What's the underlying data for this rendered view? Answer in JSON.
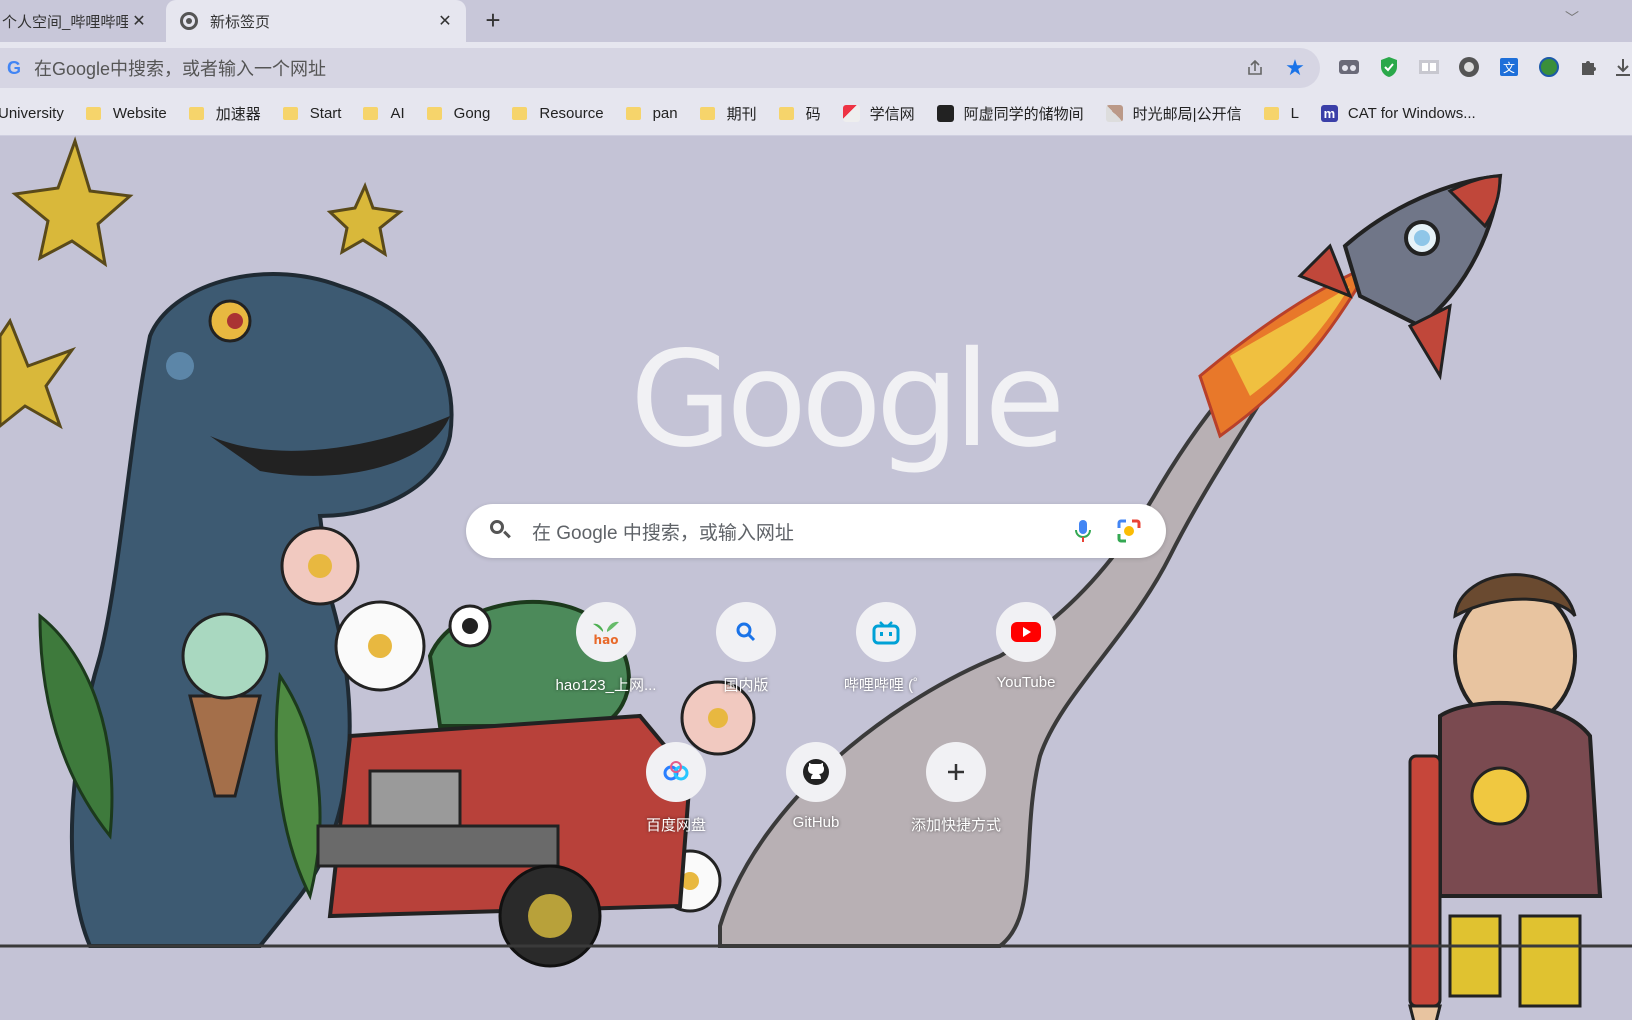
{
  "tabs": [
    {
      "title": "个人空间_哔哩哔哩",
      "active": false
    },
    {
      "title": "新标签页",
      "active": true
    }
  ],
  "omnibox": {
    "placeholder": "在Google中搜索，或者输入一个网址"
  },
  "bookmarks": [
    {
      "label": "University",
      "type": "folder"
    },
    {
      "label": "Website",
      "type": "folder"
    },
    {
      "label": "加速器",
      "type": "folder"
    },
    {
      "label": "Start",
      "type": "folder"
    },
    {
      "label": "AI",
      "type": "folder"
    },
    {
      "label": "Gong",
      "type": "folder"
    },
    {
      "label": "Resource",
      "type": "folder"
    },
    {
      "label": "pan",
      "type": "folder"
    },
    {
      "label": "期刊",
      "type": "folder"
    },
    {
      "label": "码",
      "type": "folder"
    },
    {
      "label": "学信网",
      "type": "site"
    },
    {
      "label": "阿虚同学的储物间",
      "type": "site"
    },
    {
      "label": "时光邮局|公开信",
      "type": "site"
    },
    {
      "label": "L",
      "type": "folder"
    },
    {
      "label": "CAT for Windows...",
      "type": "site"
    }
  ],
  "ntp": {
    "logo": "Google",
    "search_placeholder": "在 Google 中搜索，或输入网址",
    "shortcuts": [
      {
        "label": "hao123_上网...",
        "icon": "hao123-icon"
      },
      {
        "label": "国内版",
        "icon": "bing-search-icon"
      },
      {
        "label": "哔哩哔哩 (゜",
        "icon": "bilibili-icon"
      },
      {
        "label": "YouTube",
        "icon": "youtube-icon"
      },
      {
        "label": "百度网盘",
        "icon": "baidu-pan-icon"
      },
      {
        "label": "GitHub",
        "icon": "github-icon"
      },
      {
        "label": "添加快捷方式",
        "icon": "plus-icon"
      }
    ]
  },
  "colors": {
    "background": "#c4c3d6",
    "toolbar": "#e6e6ef",
    "accent_star": "#1a73e8",
    "youtube_red": "#ff0000",
    "bilibili_blue": "#00a1d6"
  }
}
